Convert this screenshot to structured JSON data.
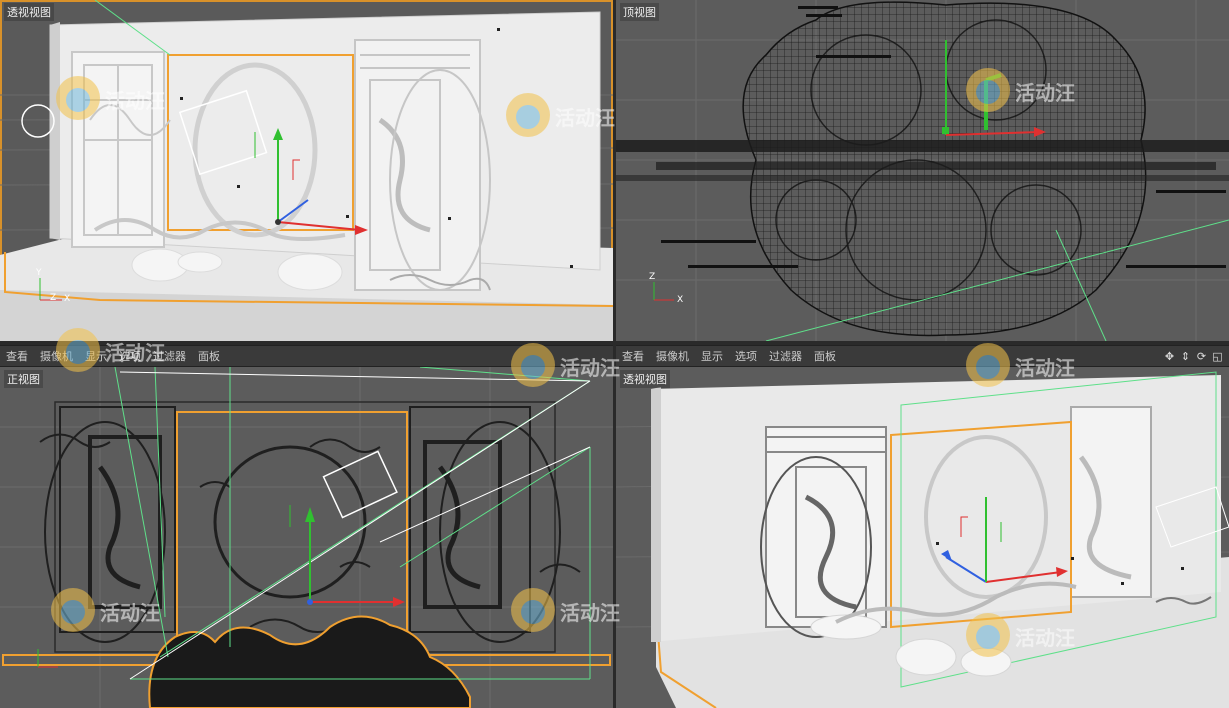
{
  "viewports": {
    "top_left": {
      "label": "透视视图"
    },
    "top_right": {
      "label": "顶视图"
    },
    "bottom_left": {
      "label": "正视图"
    },
    "bottom_right": {
      "label": "透视视图"
    }
  },
  "menu": {
    "items": [
      "查看",
      "摄像机",
      "显示",
      "选项",
      "过滤器",
      "面板"
    ]
  },
  "watermark": {
    "text": "活动汪"
  },
  "axis_labels": {
    "y": "Y",
    "z": "Z",
    "x": "X"
  },
  "colors": {
    "viewport_bg": "#5d5d5d",
    "active_border": "#d8912a",
    "axis_x": "#e03030",
    "axis_y": "#30c030",
    "axis_z": "#3060e0",
    "camera_line": "#5fe08a",
    "selection": "#f0a030"
  },
  "icons": [
    "move-view-icon",
    "zoom-view-icon",
    "rotate-view-icon",
    "maximize-view-icon"
  ]
}
